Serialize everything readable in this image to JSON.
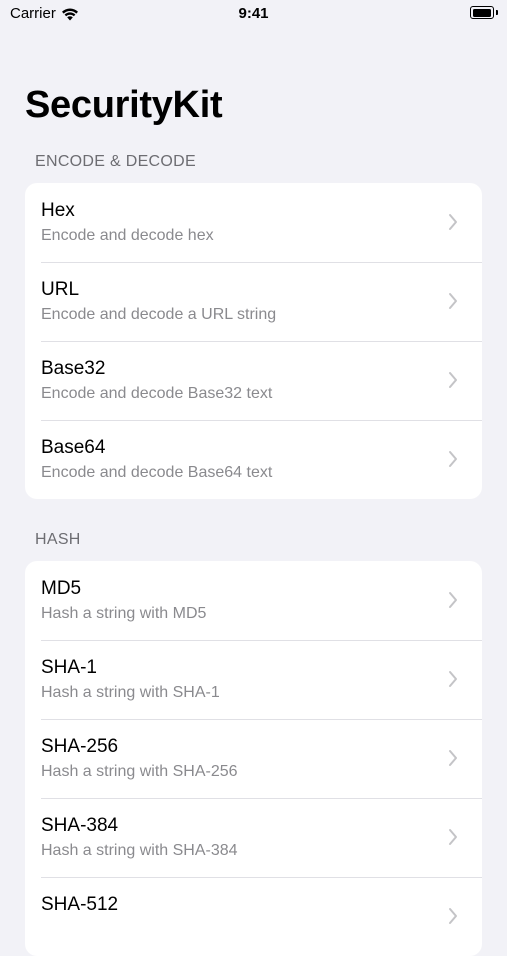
{
  "status_bar": {
    "carrier": "Carrier",
    "time": "9:41",
    "icons": [
      "wifi-icon",
      "battery-icon"
    ]
  },
  "title": "SecurityKit",
  "sections": [
    {
      "header": "ENCODE & DECODE",
      "items": [
        {
          "title": "Hex",
          "subtitle": "Encode and decode hex"
        },
        {
          "title": "URL",
          "subtitle": "Encode and decode a URL string"
        },
        {
          "title": "Base32",
          "subtitle": "Encode and decode Base32 text"
        },
        {
          "title": "Base64",
          "subtitle": "Encode and decode Base64 text"
        }
      ]
    },
    {
      "header": "HASH",
      "items": [
        {
          "title": "MD5",
          "subtitle": "Hash a string with MD5"
        },
        {
          "title": "SHA-1",
          "subtitle": "Hash a string with SHA-1"
        },
        {
          "title": "SHA-256",
          "subtitle": "Hash a string with SHA-256"
        },
        {
          "title": "SHA-384",
          "subtitle": "Hash a string with SHA-384"
        },
        {
          "title": "SHA-512",
          "subtitle": ""
        }
      ]
    }
  ],
  "colors": {
    "background": "#F2F2F7",
    "card": "#FFFFFF",
    "secondary_text": "#8A8A8E",
    "section_header": "#6D6D72",
    "chevron": "#C4C4C7"
  }
}
